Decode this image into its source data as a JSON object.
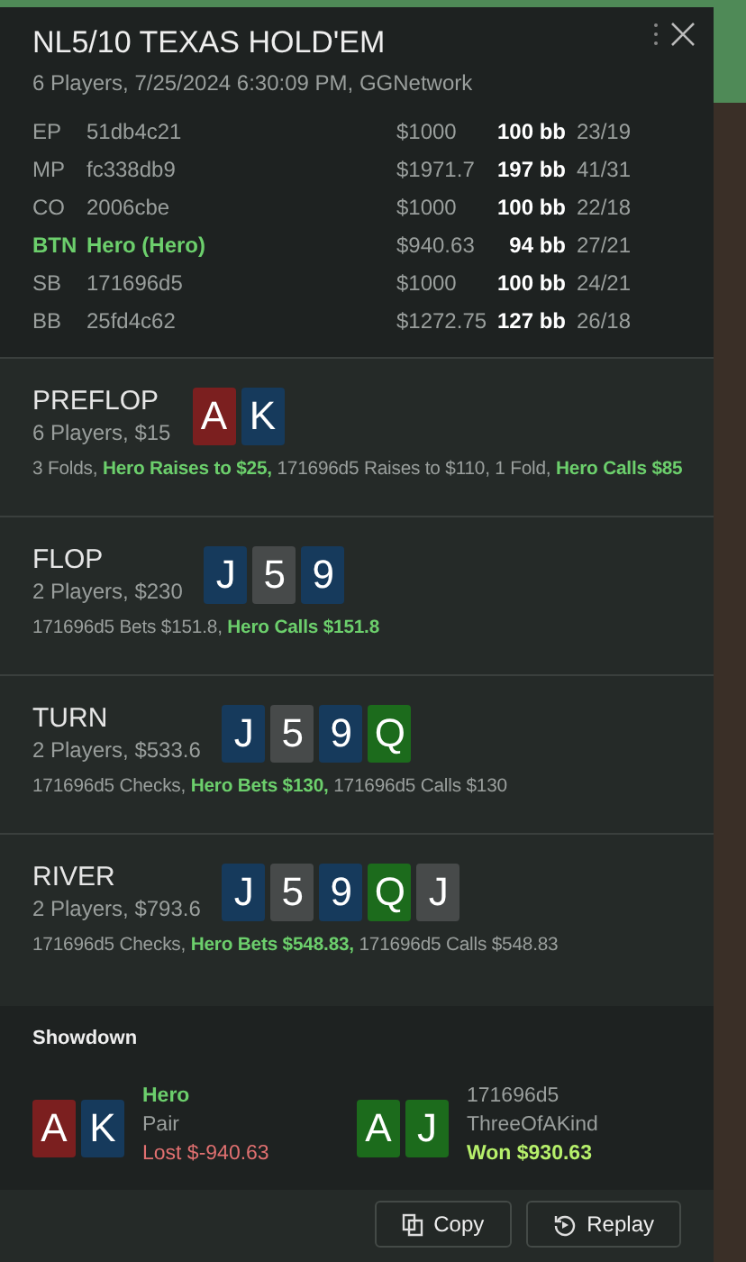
{
  "header": {
    "title": "NL5/10 TEXAS HOLD'EM",
    "subtitle": "6 Players, 7/25/2024 6:30:09 PM, GGNetwork"
  },
  "players": [
    {
      "position": "EP",
      "name": "51db4c21",
      "stack": "$1000",
      "bb": "100 bb",
      "stats": "23/19",
      "hero": false
    },
    {
      "position": "MP",
      "name": "fc338db9",
      "stack": "$1971.7",
      "bb": "197 bb",
      "stats": "41/31",
      "hero": false
    },
    {
      "position": "CO",
      "name": "2006cbe",
      "stack": "$1000",
      "bb": "100 bb",
      "stats": "22/18",
      "hero": false
    },
    {
      "position": "BTN",
      "name": "Hero (Hero)",
      "stack": "$940.63",
      "bb": "94 bb",
      "stats": "27/21",
      "hero": true
    },
    {
      "position": "SB",
      "name": "171696d5",
      "stack": "$1000",
      "bb": "100 bb",
      "stats": "24/21",
      "hero": false
    },
    {
      "position": "BB",
      "name": "25fd4c62",
      "stack": "$1272.75",
      "bb": "127 bb",
      "stats": "26/18",
      "hero": false
    }
  ],
  "streets": [
    {
      "name": "PREFLOP",
      "info": "6 Players, $15",
      "cards": [
        {
          "rank": "A",
          "color": "#7b1f1f"
        },
        {
          "rank": "K",
          "color": "#163a5c"
        }
      ],
      "actions": [
        {
          "text": "3 Folds, ",
          "hero": false
        },
        {
          "text": "Hero Raises to $25,",
          "hero": true
        },
        {
          "text": " 171696d5 Raises to $110, 1 Fold, ",
          "hero": false
        },
        {
          "text": "Hero Calls $85",
          "hero": true
        }
      ]
    },
    {
      "name": "FLOP",
      "info": "2 Players, $230",
      "cards": [
        {
          "rank": "J",
          "color": "#163a5c"
        },
        {
          "rank": "5",
          "color": "#474a4a"
        },
        {
          "rank": "9",
          "color": "#163a5c"
        }
      ],
      "actions": [
        {
          "text": "171696d5 Bets $151.8, ",
          "hero": false
        },
        {
          "text": "Hero Calls $151.8",
          "hero": true
        }
      ]
    },
    {
      "name": "TURN",
      "info": "2 Players, $533.6",
      "cards": [
        {
          "rank": "J",
          "color": "#163a5c"
        },
        {
          "rank": "5",
          "color": "#474a4a"
        },
        {
          "rank": "9",
          "color": "#163a5c"
        },
        {
          "rank": "Q",
          "color": "#1c6b1c"
        }
      ],
      "actions": [
        {
          "text": "171696d5 Checks, ",
          "hero": false
        },
        {
          "text": "Hero Bets $130,",
          "hero": true
        },
        {
          "text": " 171696d5 Calls $130",
          "hero": false
        }
      ]
    },
    {
      "name": "RIVER",
      "info": "2 Players, $793.6",
      "cards": [
        {
          "rank": "J",
          "color": "#163a5c"
        },
        {
          "rank": "5",
          "color": "#474a4a"
        },
        {
          "rank": "9",
          "color": "#163a5c"
        },
        {
          "rank": "Q",
          "color": "#1c6b1c"
        },
        {
          "rank": "J",
          "color": "#474a4a"
        }
      ],
      "actions": [
        {
          "text": "171696d5 Checks, ",
          "hero": false
        },
        {
          "text": "Hero Bets $548.83,",
          "hero": true
        },
        {
          "text": " 171696d5 Calls $548.83",
          "hero": false
        }
      ]
    }
  ],
  "showdown": {
    "title": "Showdown",
    "hands": [
      {
        "player": "Hero",
        "hero": true,
        "hand": "Pair",
        "result": "Lost $-940.63",
        "won": false,
        "cards": [
          {
            "rank": "A",
            "color": "#7b1f1f"
          },
          {
            "rank": "K",
            "color": "#163a5c"
          }
        ]
      },
      {
        "player": "171696d5",
        "hero": false,
        "hand": "ThreeOfAKind",
        "result": "Won $930.63",
        "won": true,
        "cards": [
          {
            "rank": "A",
            "color": "#1c6b1c"
          },
          {
            "rank": "J",
            "color": "#1c6b1c"
          }
        ]
      }
    ]
  },
  "buttons": [
    {
      "label": "Copy",
      "kind": "copy"
    },
    {
      "label": "Replay",
      "kind": "replay"
    }
  ]
}
